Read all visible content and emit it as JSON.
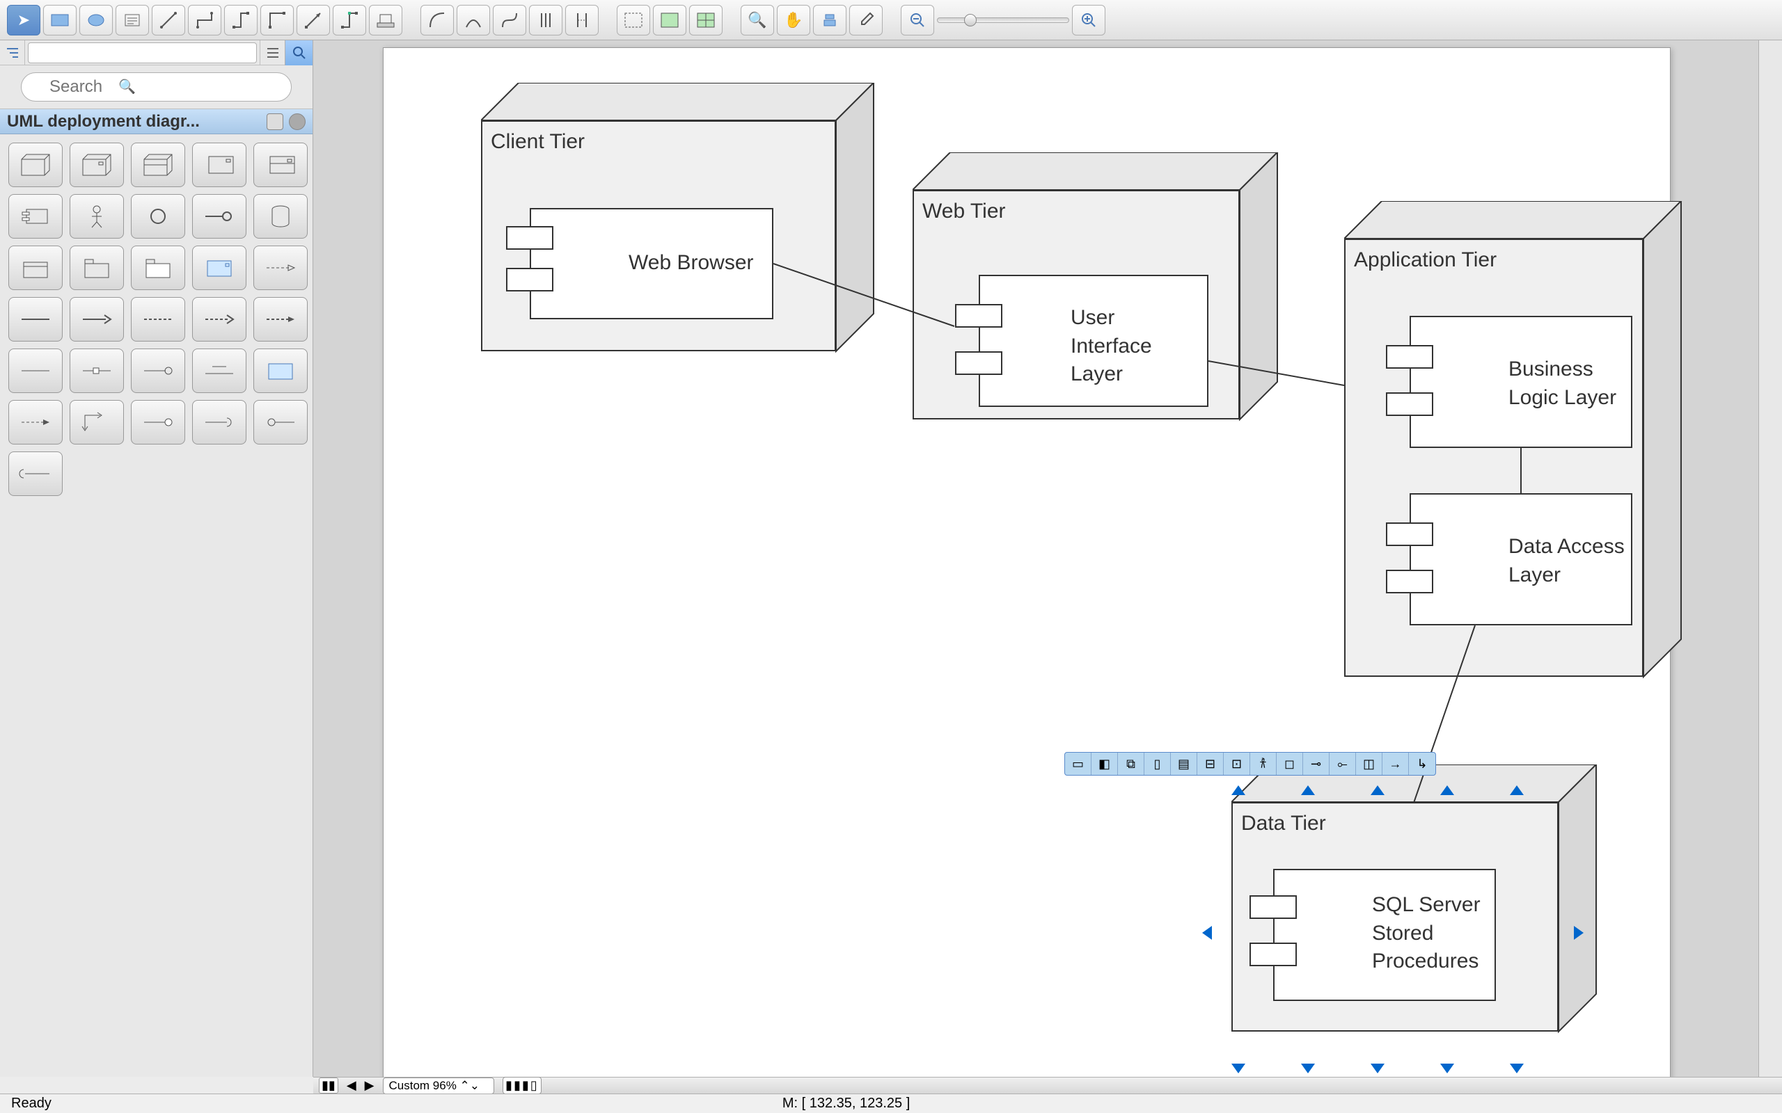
{
  "toolbar_icons": [
    "pointer",
    "rectangle",
    "ellipse",
    "text",
    "line1",
    "line2",
    "line3",
    "line4",
    "line5",
    "line6",
    "stamp",
    "curve1",
    "curve2",
    "curve3",
    "bracket1",
    "bracket2",
    "region1",
    "region2",
    "region3",
    "zoom-in",
    "pan",
    "stack",
    "dropper",
    "zoom-out",
    "zoom-max"
  ],
  "sidebar": {
    "search_placeholder": "Search",
    "palette_title": "UML deployment diagr..."
  },
  "diagram": {
    "nodes": [
      {
        "id": "client",
        "title": "Client Tier",
        "component": "Web Browser"
      },
      {
        "id": "web",
        "title": "Web Tier",
        "component": "User Interface Layer"
      },
      {
        "id": "app",
        "title": "Application Tier",
        "components": [
          "Business Logic Layer",
          "Data Access Layer"
        ]
      },
      {
        "id": "data",
        "title": "Data Tier",
        "component": "SQL Server Stored Procedures"
      }
    ],
    "connectors": [
      [
        "client",
        "web"
      ],
      [
        "web",
        "app"
      ],
      [
        "app-bll",
        "app-dal"
      ],
      [
        "app",
        "data"
      ]
    ]
  },
  "bottom": {
    "zoom_label": "Custom 96%"
  },
  "status": {
    "ready": "Ready",
    "mouse": "M: [ 132.35, 123.25 ]"
  }
}
